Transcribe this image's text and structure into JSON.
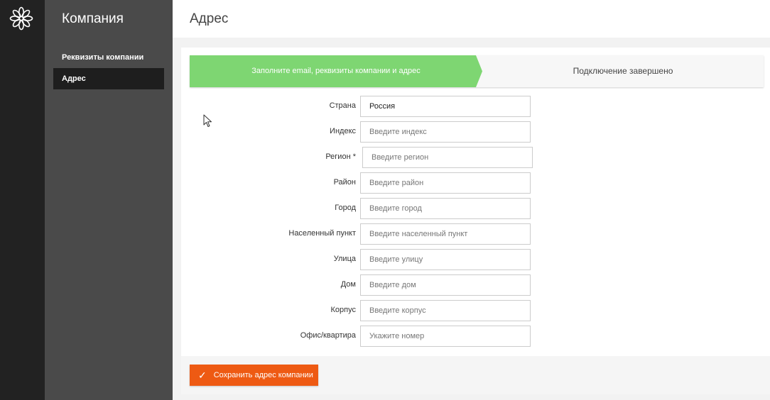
{
  "sidebar": {
    "title": "Компания",
    "items": [
      {
        "label": "Реквизиты компании"
      },
      {
        "label": "Адрес"
      }
    ]
  },
  "header": {
    "title": "Адрес"
  },
  "steps": {
    "step1": "Заполните email, реквизиты компании и адрес",
    "step2": "Подключение завершено"
  },
  "form": {
    "fields": [
      {
        "label": "Страна",
        "value": "Россия",
        "placeholder": ""
      },
      {
        "label": "Индекс",
        "value": "",
        "placeholder": "Введите индекс"
      },
      {
        "label": "Регион *",
        "value": "",
        "placeholder": "Введите регион"
      },
      {
        "label": "Район",
        "value": "",
        "placeholder": "Введите район"
      },
      {
        "label": "Город",
        "value": "",
        "placeholder": "Введите город"
      },
      {
        "label": "Населенный пункт",
        "value": "",
        "placeholder": "Введите населенный пункт"
      },
      {
        "label": "Улица",
        "value": "",
        "placeholder": "Введите улицу"
      },
      {
        "label": "Дом",
        "value": "",
        "placeholder": "Введите дом"
      },
      {
        "label": "Корпус",
        "value": "",
        "placeholder": "Введите корпус"
      },
      {
        "label": "Офис/квартира",
        "value": "",
        "placeholder": "Укажите номер"
      }
    ]
  },
  "actions": {
    "save_label": "Сохранить адрес компании"
  },
  "colors": {
    "rail": "#222222",
    "sidebar": "#4a4a4a",
    "sidebar_active": "#1e1e1e",
    "step_active": "#7ed672",
    "accent": "#ee5a13"
  },
  "icons": {
    "logo": "flower-logo-icon",
    "check": "check-icon",
    "cursor": "mouse-cursor-icon"
  }
}
